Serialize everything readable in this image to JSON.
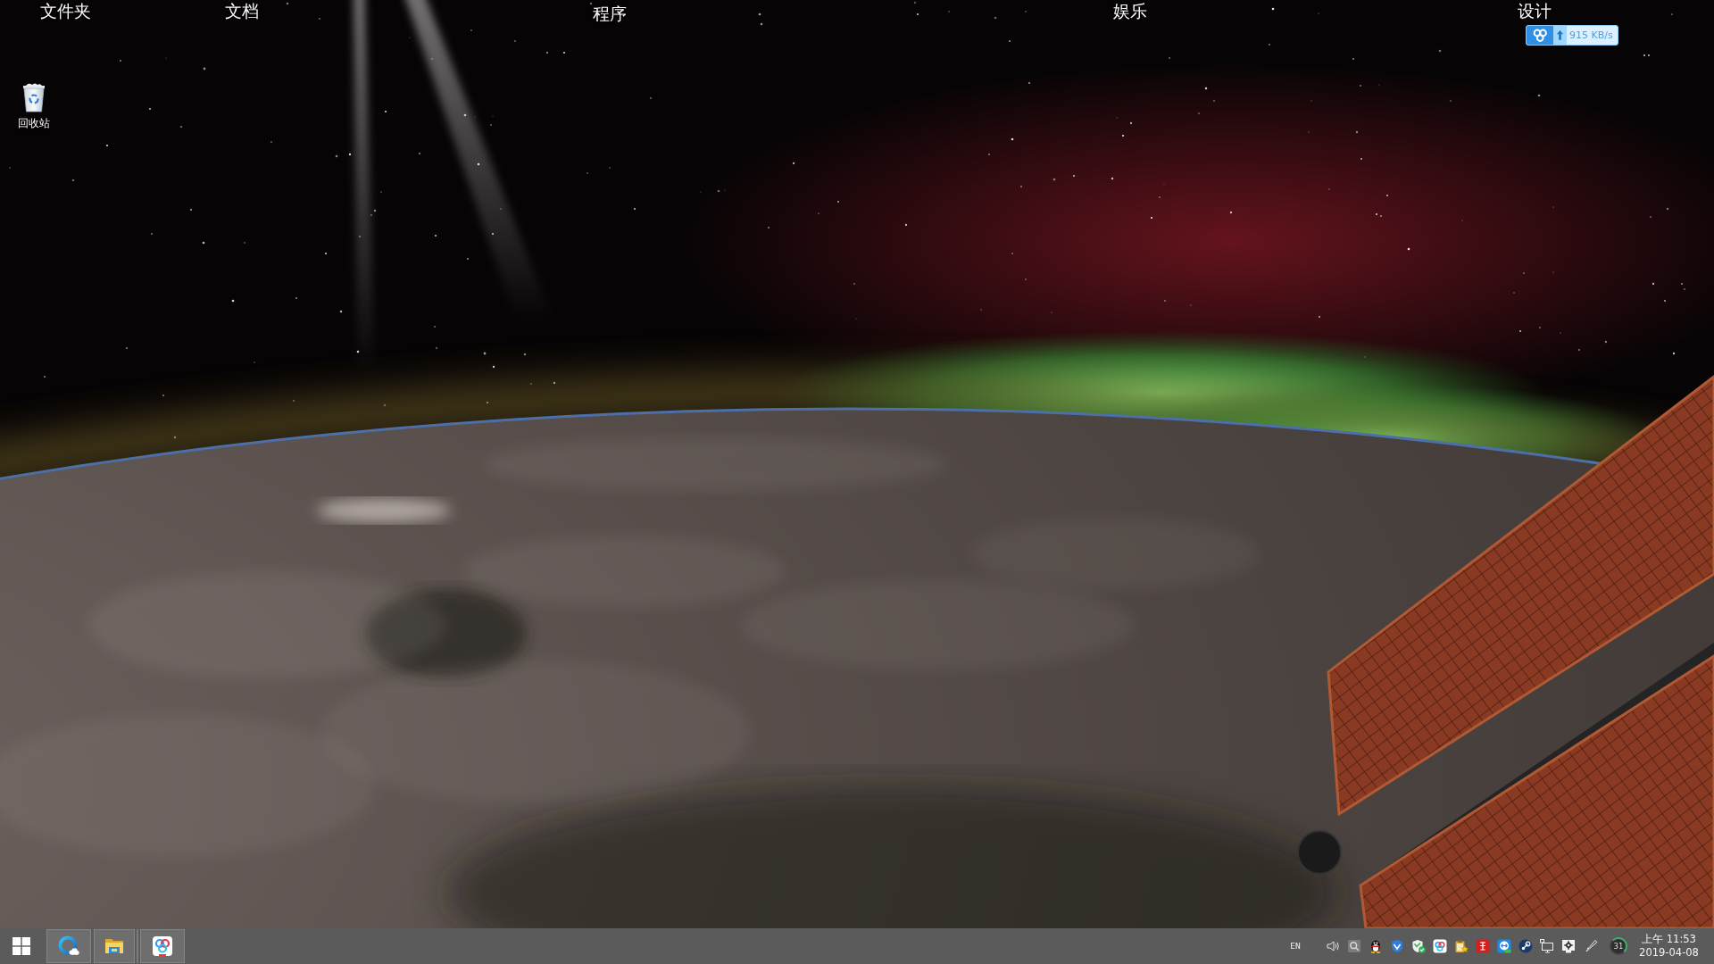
{
  "desktop": {
    "fences": [
      {
        "title": "文件夹"
      },
      {
        "title": "文档"
      },
      {
        "title": "程序"
      },
      {
        "title": "娱乐"
      },
      {
        "title": "设计"
      }
    ],
    "shortcuts": [
      {
        "label": "回收站"
      }
    ]
  },
  "speed_widget": {
    "reading": "915 KB/s"
  },
  "taskbar": {
    "apps": [
      {
        "running": true
      },
      {
        "running": true
      },
      {
        "running": true
      }
    ],
    "language": "EN",
    "gauge": "31",
    "clock": {
      "time": "上午 11:53",
      "date": "2019-04-08"
    }
  }
}
